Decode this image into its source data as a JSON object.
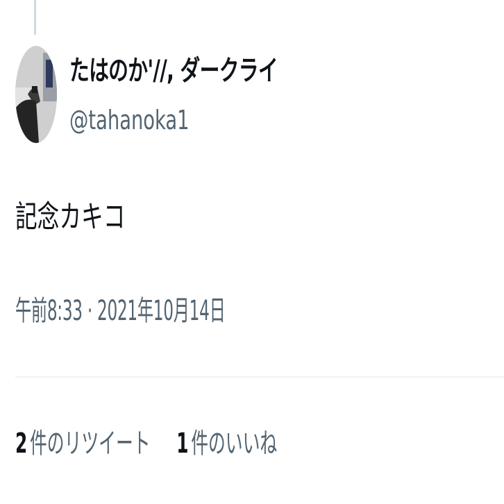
{
  "tweet": {
    "author": {
      "display_name": "たはのか'//, ダークライ",
      "handle": "@tahanoka1"
    },
    "text": "記念カキコ",
    "timestamp": "午前8:33 · 2021年10月14日",
    "stats": {
      "retweets_count": "2",
      "retweets_label": "件のリツイート",
      "likes_count": "1",
      "likes_label": "件のいいね"
    }
  },
  "colors": {
    "text_primary": "#0f1419",
    "text_secondary": "#536471",
    "divider": "#eff3f4",
    "thread_line": "#cfd9de"
  }
}
